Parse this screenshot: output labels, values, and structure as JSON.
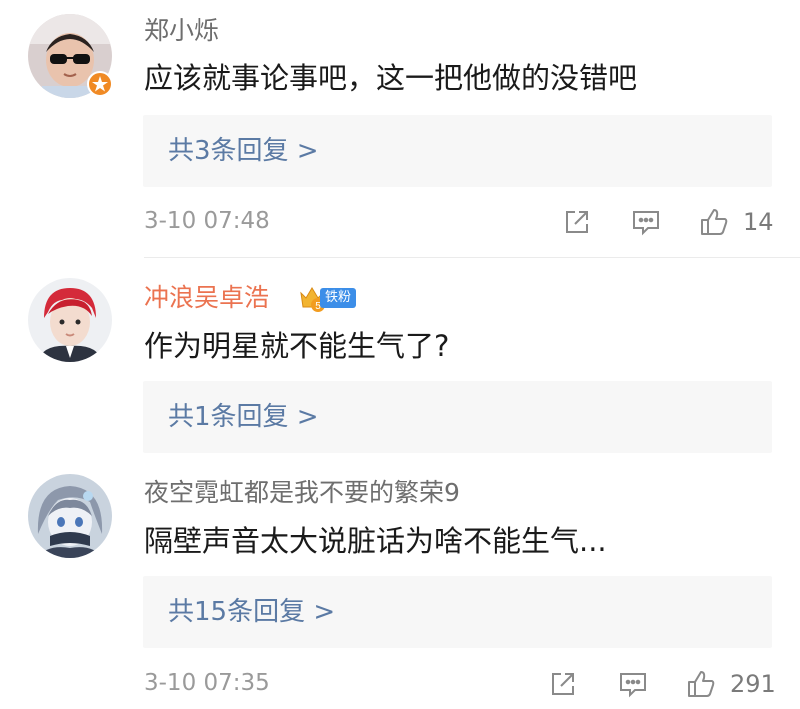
{
  "comments": [
    {
      "username": "郑小烁",
      "text": "应该就事论事吧，这一把他做的没错吧",
      "reply_label": "共3条回复 >",
      "time": "3-10 07:48",
      "like_count": "14"
    },
    {
      "username": "冲浪吴卓浩",
      "badge": "铁粉",
      "badge_level": "5",
      "text": "作为明星就不能生气了?",
      "reply_label": "共1条回复 >"
    },
    {
      "username": "夜空霓虹都是我不要的繁荣9",
      "text": "隔壁声音太大说脏话为啥不能生气...",
      "reply_label": "共15条回复 >",
      "time": "3-10 07:35",
      "like_count": "291"
    }
  ],
  "icons": [
    "verified-badge-icon",
    "crown-icon",
    "share-icon",
    "comment-icon",
    "like-icon"
  ],
  "colors": {
    "username": "#6e6e6e",
    "vip_username": "#eb7350",
    "reply_link": "#5b7aa4",
    "reply_background": "#f7f7f7",
    "badge": "#3c8ee8",
    "verify_badge": "#f5a623"
  }
}
